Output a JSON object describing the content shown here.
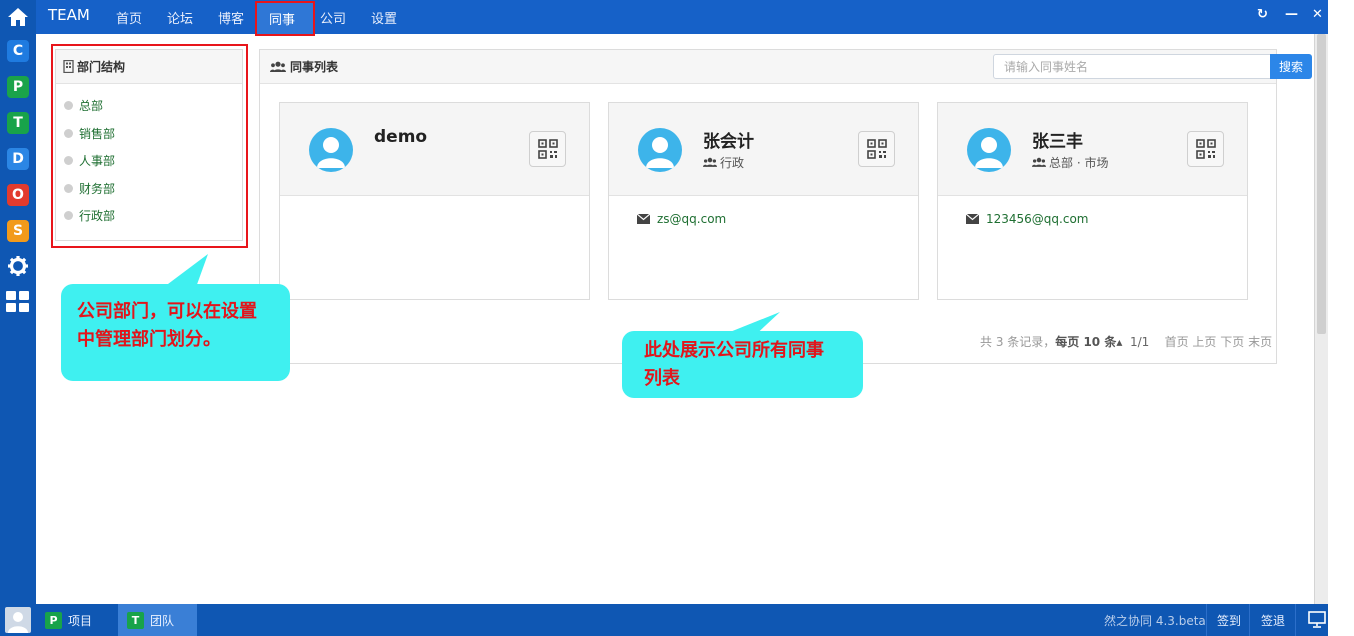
{
  "topbar": {
    "brand": "TEAM",
    "nav": [
      "首页",
      "论坛",
      "博客",
      "同事",
      "公司",
      "设置"
    ],
    "active_index": 3
  },
  "rail": {
    "apps": [
      {
        "letter": "C",
        "color": "#1f7be0"
      },
      {
        "letter": "P",
        "color": "#1aa34a"
      },
      {
        "letter": "T",
        "color": "#18a34a"
      },
      {
        "letter": "D",
        "color": "#2b86e5"
      },
      {
        "letter": "O",
        "color": "#e23b2e"
      },
      {
        "letter": "S",
        "color": "#f29a1b"
      }
    ]
  },
  "dept_panel": {
    "title": "部门结构",
    "items": [
      "总部",
      "销售部",
      "人事部",
      "财务部",
      "行政部"
    ]
  },
  "colleagues": {
    "title": "同事列表",
    "search_placeholder": "请输入同事姓名",
    "search_button": "搜索",
    "cards": [
      {
        "name": "demo",
        "dept": "",
        "email": ""
      },
      {
        "name": "张会计",
        "dept": "行政",
        "email": "zs@qq.com"
      },
      {
        "name": "张三丰",
        "dept": "总部 · 市场",
        "email": "123456@qq.com"
      }
    ],
    "pager": {
      "total": "共 3 条记录，",
      "per_page": "每页 10 条",
      "pages": "1/1",
      "first": "首页",
      "prev": "上页",
      "next": "下页",
      "last": "末页"
    }
  },
  "callouts": {
    "left": "公司部门，可以在设置中管理部门划分。",
    "right": "此处展示公司所有同事列表"
  },
  "taskbar": {
    "items": [
      {
        "icon": "P",
        "label": "项目"
      },
      {
        "icon": "T",
        "label": "团队"
      }
    ],
    "version": "然之协同 4.3.beta",
    "sign_in": "签到",
    "sign_out": "签退"
  }
}
